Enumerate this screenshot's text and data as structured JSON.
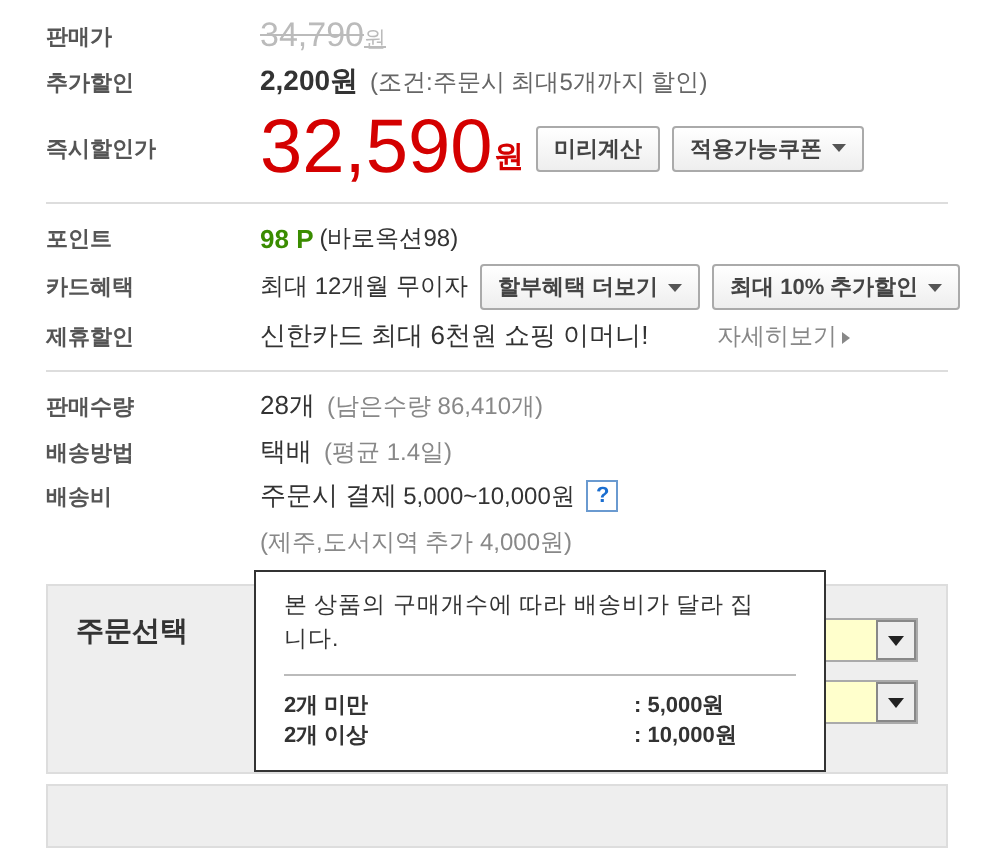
{
  "price_rows": [
    {
      "label": "판매가",
      "kind": "original",
      "amount": "34,790",
      "unit": "원"
    },
    {
      "label": "추가할인",
      "kind": "discount",
      "amount": "2,200원",
      "note": "(조건:주문시 최대5개까지 할인)"
    },
    {
      "label": "즉시할인가",
      "kind": "final",
      "amount": "32,590",
      "unit": "원",
      "buttons": [
        {
          "label": "미리계산",
          "dropdown": false
        },
        {
          "label": "적용가능쿠폰",
          "dropdown": true
        }
      ]
    }
  ],
  "benefit_rows": [
    {
      "label": "포인트",
      "kind": "points",
      "amount": "98 P",
      "note": "(바로옥션98)"
    },
    {
      "label": "카드혜택",
      "kind": "card",
      "text": "최대 12개월 무이자",
      "buttons": [
        {
          "label": "할부혜택 더보기",
          "dropdown": true
        },
        {
          "label": "최대 10% 추가할인",
          "dropdown": true
        }
      ]
    },
    {
      "label": "제휴할인",
      "kind": "partner",
      "text": "신한카드 최대 6천원 쇼핑 이머니!",
      "link": "자세히보기"
    }
  ],
  "shipping_rows": [
    {
      "label": "판매수량",
      "kind": "quantity",
      "text": "28개",
      "note": "(남은수량 86,410개)"
    },
    {
      "label": "배송방법",
      "kind": "method",
      "text": "택배",
      "note": "(평균 1.4일)"
    },
    {
      "label": "배송비",
      "kind": "fee",
      "text": "주문시 결제",
      "amount": "5,000~10,000원",
      "help": "?",
      "note": "(제주,도서지역 추가 4,000원)"
    }
  ],
  "order": {
    "label": "주문선택",
    "selects": [
      {
        "kind": "dropdown"
      },
      {
        "kind": "dropdown"
      }
    ]
  },
  "tooltip": {
    "message": "본 상품의 구매개수에 따라 배송비가 달라 집니다.",
    "tiers": [
      {
        "condition": "2개 미만",
        "fee": ": 5,000원"
      },
      {
        "condition": "2개 이상",
        "fee": ": 10,000원"
      }
    ]
  }
}
